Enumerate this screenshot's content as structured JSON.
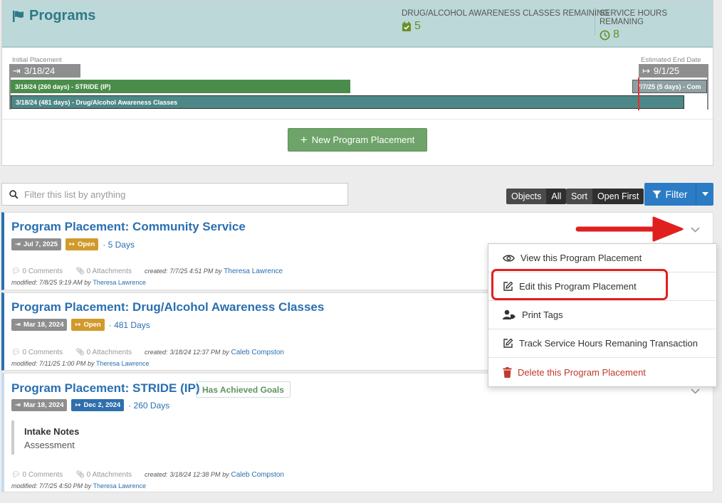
{
  "header": {
    "title": "Programs",
    "stats": [
      {
        "label": "DRUG/ALCOHOL AWARENESS CLASSES REMAINING",
        "value": "5"
      },
      {
        "label": "SERVICE HOURS REMANING",
        "value": "8"
      }
    ]
  },
  "timeline": {
    "start_label": "Initial Placement",
    "start_date": "3/18/24",
    "end_label": "Estimated End Date",
    "end_date": "9/1/25",
    "bars": [
      {
        "text": "3/18/24 (260 days) - STRIDE (IP)",
        "color": "#4a8c4a"
      },
      {
        "text": "7/7/25 (5 days) - Com",
        "color": "#8ea0a3"
      },
      {
        "text": "3/18/24 (481 days) - Drug/Alcohol Awareness Classes",
        "color": "#4d8787"
      }
    ]
  },
  "new_button": "New Program Placement",
  "search": {
    "placeholder": "Filter this list by anything"
  },
  "pills": {
    "objects_label": "Objects",
    "objects_value": "All",
    "sort_label": "Sort",
    "sort_value": "Open First"
  },
  "filter_label": "Filter",
  "cards": [
    {
      "title": "Program Placement: Community Service",
      "badge1": "Jul 7, 2025",
      "badge2": "Open",
      "days": "· 5 Days",
      "comments": "0 Comments",
      "attachments": "0 Attachments",
      "created_prefix": "created:",
      "created": "7/7/25 4:51 PM",
      "created_by_word": "by",
      "created_by": "Theresa Lawrence",
      "modified_prefix": "modified:",
      "modified": "7/8/25 9:19 AM",
      "modified_by_word": "by",
      "modified_by": "Theresa Lawrence"
    },
    {
      "title": "Program Placement: Drug/Alcohol Awareness Classes",
      "badge1": "Mar 18, 2024",
      "badge2": "Open",
      "days": "· 481 Days",
      "comments": "0 Comments",
      "attachments": "0 Attachments",
      "created_prefix": "created:",
      "created": "3/18/24 12:37 PM",
      "created_by_word": "by",
      "created_by": "Caleb Compston",
      "modified_prefix": "modified:",
      "modified": "7/11/25 1:00 PM",
      "modified_by_word": "by",
      "modified_by": "Theresa Lawrence"
    },
    {
      "title": "Program Placement: STRIDE (IP)",
      "goals": "Has Achieved Goals",
      "badge1": "Mar 18, 2024",
      "badge2": "Dec 2, 2024",
      "days": "· 260 Days",
      "intake_title": "Intake Notes",
      "intake_body": "Assessment",
      "comments": "0 Comments",
      "attachments": "0 Attachments",
      "created_prefix": "created:",
      "created": "3/18/24 12:38 PM",
      "created_by_word": "by",
      "created_by": "Caleb Compston",
      "modified_prefix": "modified:",
      "modified": "7/7/25 4:50 PM",
      "modified_by_word": "by",
      "modified_by": "Theresa Lawrence"
    }
  ],
  "menu": [
    "View this Program Placement",
    "Edit this Program Placement",
    "Print Tags",
    "Track Service Hours Remaning Transaction",
    "Delete this Program Placement"
  ],
  "colors": {
    "primary": "#2a6fb0",
    "success": "#6ea46a",
    "warning": "#d19a2a",
    "danger": "#c0392b",
    "highlight": "#e0201f"
  }
}
